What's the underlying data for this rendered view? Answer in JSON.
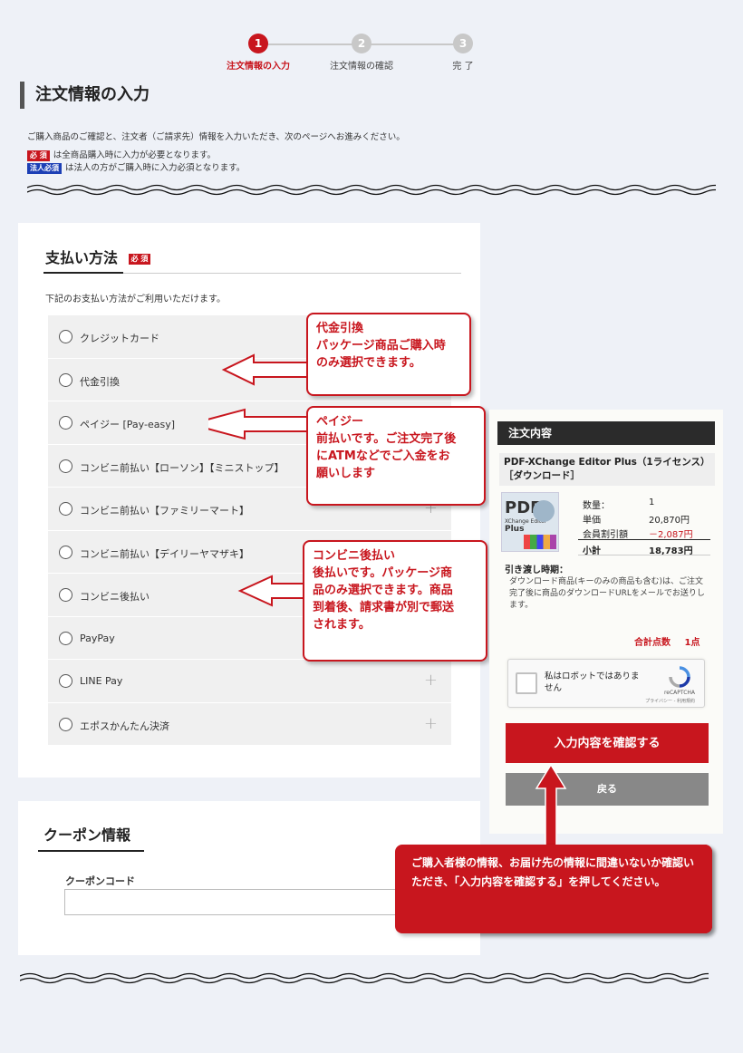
{
  "steps": [
    {
      "num": "1",
      "label": "注文情報の入力"
    },
    {
      "num": "2",
      "label": "注文情報の確認"
    },
    {
      "num": "3",
      "label": "完 了"
    }
  ],
  "page_title": "注文情報の入力",
  "intro": {
    "text": "ご購入商品のご確認と、注文者（ご請求先）情報を入力いただき、次のページへお進みください。",
    "required_badge": "必 須",
    "required_text": "は全商品購入時に入力が必要となります。",
    "corp_badge": "法人必須",
    "corp_text": "は法人の方がご購入時に入力必須となります。"
  },
  "payment": {
    "title": "支払い方法",
    "badge": "必 須",
    "description": "下記のお支払い方法がご利用いただけます。",
    "methods": [
      {
        "label": "クレジットカード"
      },
      {
        "label": "代金引換"
      },
      {
        "label": "ペイジー [Pay-easy]"
      },
      {
        "label": "コンビニ前払い【ローソン】【ミニストップ】"
      },
      {
        "label": "コンビニ前払い【ファミリーマート】"
      },
      {
        "label": "コンビニ前払い【デイリーヤマザキ】"
      },
      {
        "label": "コンビニ後払い"
      },
      {
        "label": "PayPay"
      },
      {
        "label": "LINE Pay"
      },
      {
        "label": "エポスかんたん決済"
      }
    ]
  },
  "callouts": {
    "cod": {
      "title": "代金引換",
      "line1": "パッケージ商品ご購入時",
      "line2": "のみ選択できます。"
    },
    "payeasy": {
      "title": "ペイジー",
      "line1": "前払いです。ご注文完了後",
      "line2": "にATMなどでご入金をお",
      "line3": "願いします"
    },
    "konbini": {
      "title": "コンビニ後払い",
      "line1": "後払いです。パッケージ商",
      "line2": "品のみ選択できます。商品",
      "line3": "到着後、請求書が別で郵送",
      "line4": "されます。"
    }
  },
  "order": {
    "header": "注文内容",
    "product_name": "PDF-XChange Editor Plus（1ライセンス）［ダウンロード］",
    "product_image_text": {
      "l1": "PDF",
      "l2": "XChange Editor",
      "l3": "Plus"
    },
    "rows": [
      {
        "label": "数量：",
        "value": "1"
      },
      {
        "label": "単価",
        "value": "20,870円"
      },
      {
        "label": "会員割引額",
        "value": "－2,087円"
      },
      {
        "label": "小計",
        "value": "18,783円"
      }
    ],
    "delivery_title": "引き渡し時期：",
    "delivery_text": "ダウンロード商品(キーのみの商品も含む)は、ご注文完了後に商品のダウンロードURLをメールでお送りします。",
    "total_label": "合計点数",
    "total_value": "1点"
  },
  "captcha": {
    "label": "私はロボットではありません",
    "brand": "reCAPTCHA",
    "links": "プライバシー - 利用規約"
  },
  "buttons": {
    "confirm": "入力内容を確認する",
    "back": "戻る"
  },
  "big_callout": "ご購入者様の情報、お届け先の情報に間違いないか確認いただき、「入力内容を確認する」を押してください。",
  "coupon": {
    "title": "クーポン情報",
    "code_label": "クーポンコード",
    "code_value": ""
  },
  "colors": {
    "accent": "#c8161e",
    "background": "#eef1f7",
    "dark": "#2b2b2b"
  }
}
